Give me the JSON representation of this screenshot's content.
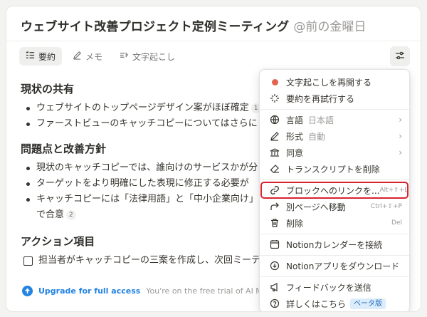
{
  "header": {
    "title": "ウェブサイト改善プロジェクト定例ミーティング",
    "date": "@前の金曜日"
  },
  "tabs": [
    {
      "label": "要約",
      "icon": "summary-icon",
      "active": true
    },
    {
      "label": "メモ",
      "icon": "pen-icon",
      "active": false
    },
    {
      "label": "文字起こし",
      "icon": "transcript-icon",
      "active": false
    }
  ],
  "notes": {
    "section1": {
      "heading": "現状の共有",
      "items": [
        {
          "text": "ウェブサイトのトップページデザイン案がほぼ確定",
          "cite": "1"
        },
        {
          "text": "ファーストビューのキャッチコピーについてはさらに"
        }
      ]
    },
    "section2": {
      "heading": "問題点と改善方針",
      "items": [
        {
          "text": "現状のキャッチコピーでは、誰向けのサービスかが分"
        },
        {
          "text": "ターゲットをより明確にした表現に修正する必要が"
        },
        {
          "text": "キャッチコピーには「法律用語」と「中小企業向け」",
          "text2": "で合意",
          "cite": "2"
        }
      ]
    },
    "section3": {
      "heading": "アクション項目",
      "todo": "担当者がキャッチコピーの三案を作成し、次回ミーテ"
    }
  },
  "upgrade": {
    "link": "Upgrade for full access",
    "note": "You're on the free trial of AI Meeting N"
  },
  "menu": {
    "resume": "文字起こしを再開する",
    "retry": "要約を再試行する",
    "language": {
      "label": "言語",
      "value": "日本語"
    },
    "format": {
      "label": "形式",
      "value": "自動"
    },
    "consent": {
      "label": "同意"
    },
    "delete_transcript": "トランスクリプトを削除",
    "copy_link": {
      "label": "ブロックへのリンクを...",
      "shortcut": "Alt+⇧+L"
    },
    "move": {
      "label": "別ページへ移動",
      "shortcut": "Ctrl+⇧+P"
    },
    "delete": {
      "label": "削除",
      "shortcut": "Del"
    },
    "calendar": "Notionカレンダーを接続",
    "download": "Notionアプリをダウンロード",
    "feedback": "フィードバックを送信",
    "learn_more": {
      "label": "詳しくはこちら",
      "badge": "ベータ版"
    }
  },
  "colors": {
    "accent": "#2383e2",
    "highlight": "#d9232e",
    "recording_dot": "#e0644f"
  }
}
